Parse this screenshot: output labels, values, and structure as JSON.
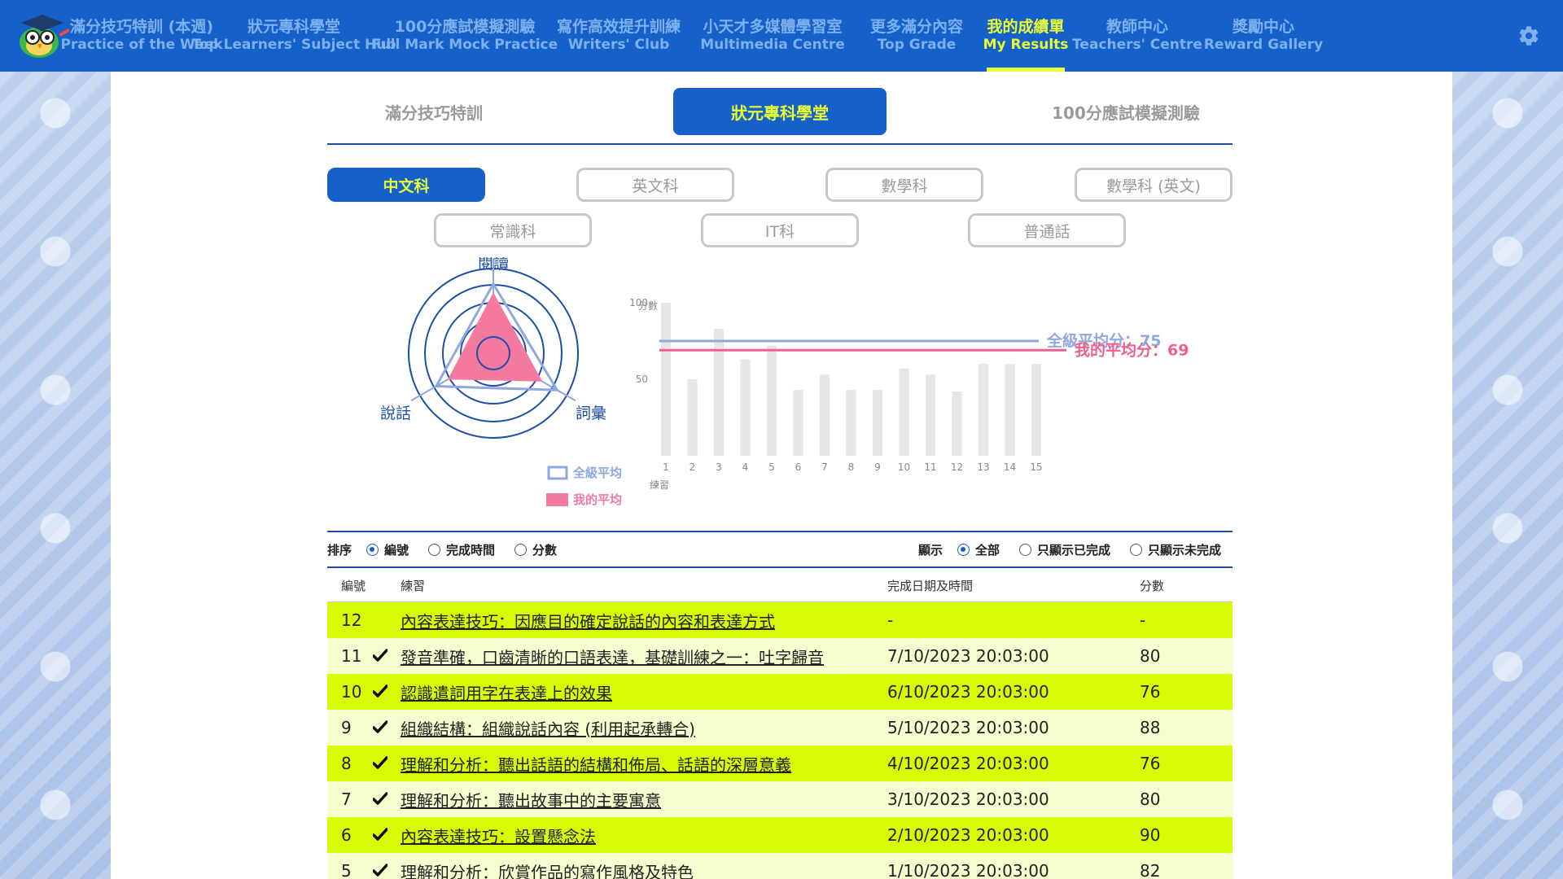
{
  "nav": {
    "items": [
      {
        "zh": "滿分技巧特訓 (本週)",
        "en": "Practice of the Week",
        "active": false
      },
      {
        "zh": "狀元專科學堂",
        "en": "Top Learners' Subject Hub",
        "active": false
      },
      {
        "zh": "100分應試模擬測驗",
        "en": "Full Mark Mock Practice",
        "active": false
      },
      {
        "zh": "寫作高效提升訓練",
        "en": "Writers' Club",
        "active": false
      },
      {
        "zh": "小天才多媒體學習室",
        "en": "Multimedia Centre",
        "active": false
      },
      {
        "zh": "更多滿分內容",
        "en": "Top Grade",
        "active": false
      },
      {
        "zh": "我的成績單",
        "en": "My Results",
        "active": true
      },
      {
        "zh": "教師中心",
        "en": "Teachers' Centre",
        "active": false
      },
      {
        "zh": "獎勵中心",
        "en": "Reward Gallery",
        "active": false
      }
    ],
    "settings_icon": "gear-icon"
  },
  "main_tabs": [
    {
      "label": "滿分技巧特訓",
      "active": false
    },
    {
      "label": "狀元專科學堂",
      "active": true
    },
    {
      "label": "100分應試模擬測驗",
      "active": false
    }
  ],
  "subjects_row1": [
    {
      "label": "中文科",
      "active": true
    },
    {
      "label": "英文科",
      "active": false
    },
    {
      "label": "數學科",
      "active": false
    },
    {
      "label": "數學科 (英文)",
      "active": false
    }
  ],
  "subjects_row2": [
    {
      "label": "常識科",
      "active": false
    },
    {
      "label": "IT科",
      "active": false
    },
    {
      "label": "普通話",
      "active": false
    }
  ],
  "radar": {
    "axes": [
      "閱讀",
      "詞彙",
      "說話"
    ],
    "class_values": [
      0.82,
      0.87,
      0.78
    ],
    "my_values": [
      0.72,
      0.67,
      0.62
    ],
    "legend": [
      "全級平均",
      "我的平均"
    ],
    "colors": {
      "ring": "#1d4fa8",
      "class": "#8fa8de",
      "mine": "#f47aa0"
    }
  },
  "chart_data": {
    "type": "bar",
    "categories": [
      "1",
      "2",
      "3",
      "4",
      "5",
      "6",
      "7",
      "8",
      "9",
      "10",
      "11",
      "12",
      "13",
      "14",
      "15"
    ],
    "values": [
      100,
      50,
      83,
      63,
      72,
      43,
      53,
      43,
      43,
      57,
      53,
      42,
      60,
      60,
      60
    ],
    "ylabel": "分數",
    "xlabel": "練習",
    "yticks": [
      50,
      100
    ],
    "ylim": [
      0,
      100
    ],
    "reference_lines": [
      {
        "label": "全級平均分：75",
        "value": 75,
        "color": "#8fa8de"
      },
      {
        "label": "我的平均分：69",
        "value": 69,
        "color": "#f0608c"
      }
    ],
    "bar_color": "#e6e6e6"
  },
  "controls": {
    "sort_label": "排序",
    "sort_options": [
      {
        "label": "編號",
        "checked": true
      },
      {
        "label": "完成時間",
        "checked": false
      },
      {
        "label": "分數",
        "checked": false
      }
    ],
    "show_label": "顯示",
    "show_options": [
      {
        "label": "全部",
        "checked": true
      },
      {
        "label": "只顯示已完成",
        "checked": false
      },
      {
        "label": "只顯示未完成",
        "checked": false
      }
    ]
  },
  "table": {
    "headers": {
      "no": "編號",
      "title": "練習",
      "date": "完成日期及時間",
      "score": "分數"
    },
    "rows": [
      {
        "no": "12",
        "done": false,
        "title": "內容表達技巧：因應目的確定說話的內容和表達方式",
        "date": "-",
        "score": "-"
      },
      {
        "no": "11",
        "done": true,
        "title": "發音準確，口齒清晰的口語表達，基礎訓練之一：吐字歸音",
        "date": "7/10/2023 20:03:00",
        "score": "80"
      },
      {
        "no": "10",
        "done": true,
        "title": "認識遣詞用字在表達上的效果",
        "date": "6/10/2023 20:03:00",
        "score": "76"
      },
      {
        "no": "9",
        "done": true,
        "title": "組織結構：組織說話內容 (利用起承轉合)",
        "date": "5/10/2023 20:03:00",
        "score": "88"
      },
      {
        "no": "8",
        "done": true,
        "title": "理解和分析：聽出話語的結構和佈局、話語的深層意義",
        "date": "4/10/2023 20:03:00",
        "score": "76"
      },
      {
        "no": "7",
        "done": true,
        "title": "理解和分析：聽出故事中的主要寓意",
        "date": "3/10/2023 20:03:00",
        "score": "80"
      },
      {
        "no": "6",
        "done": true,
        "title": "內容表達技巧：設置懸念法",
        "date": "2/10/2023 20:03:00",
        "score": "90"
      },
      {
        "no": "5",
        "done": true,
        "title": "理解和分析：欣賞作品的寫作風格及特色",
        "date": "1/10/2023 20:03:00",
        "score": "82"
      }
    ],
    "check_icon": "checkmark-icon"
  }
}
